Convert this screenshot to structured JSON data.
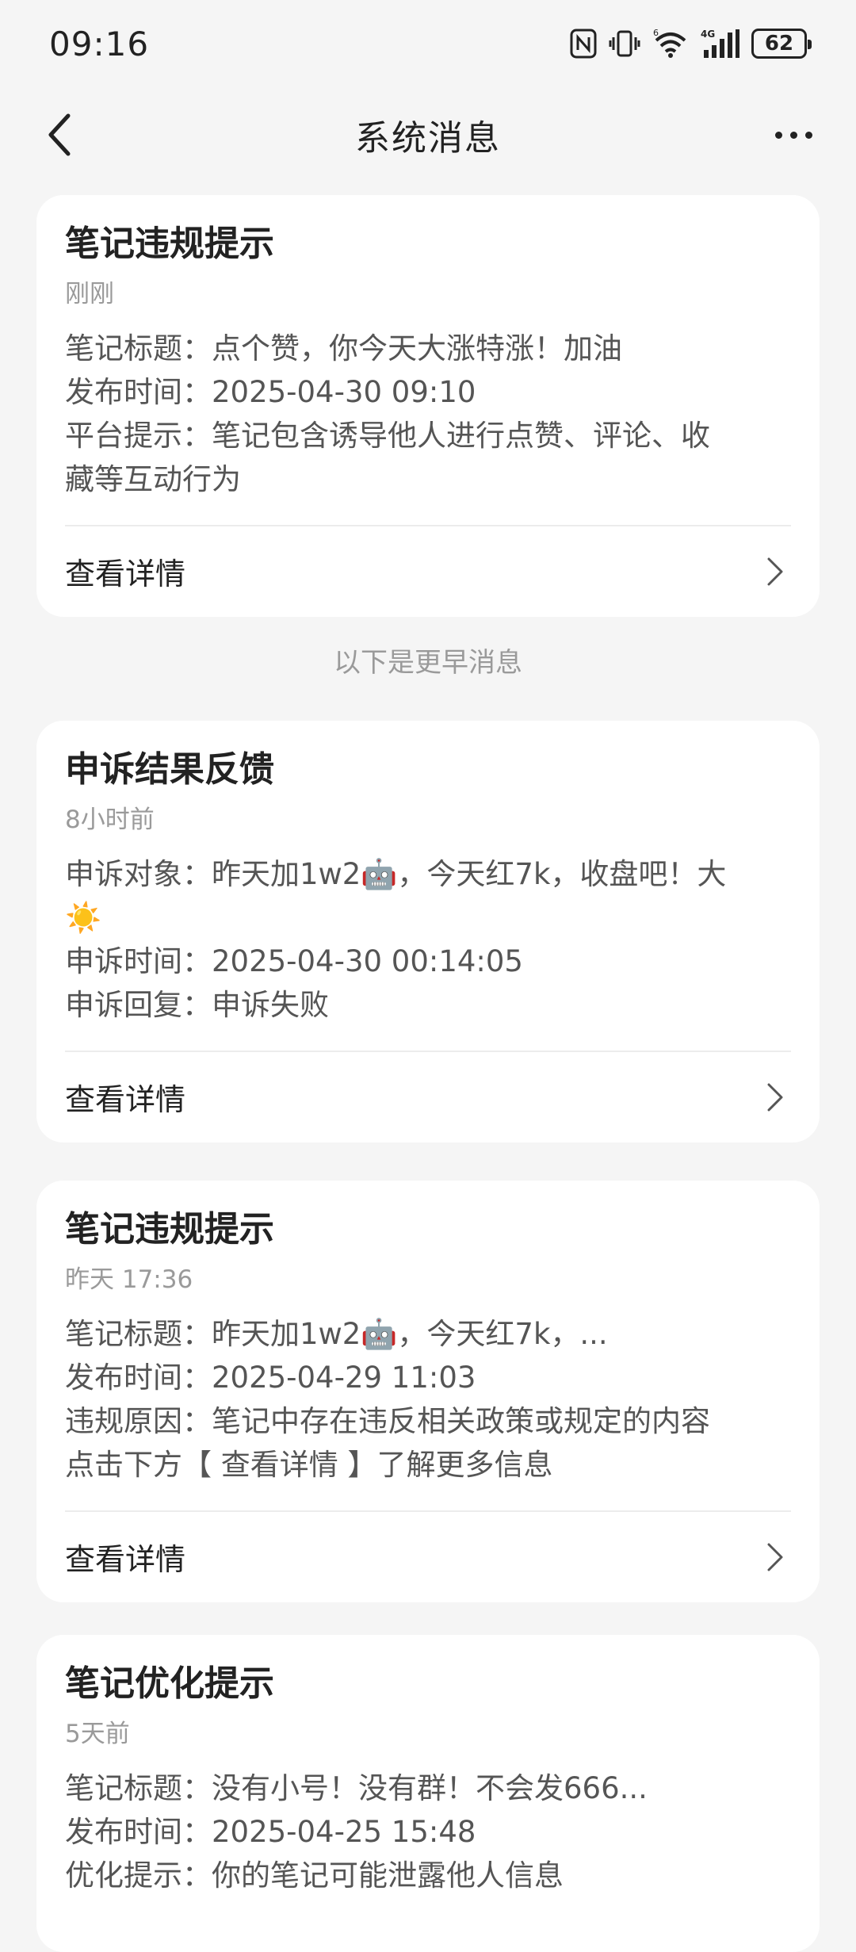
{
  "status_bar": {
    "time": "09:16",
    "battery": "62",
    "signal_label": "4G",
    "wifi_label": "6"
  },
  "nav": {
    "title": "系统消息"
  },
  "separator_text": "以下是更早消息",
  "cards": [
    {
      "title": "笔记违规提示",
      "time": "刚刚",
      "lines": [
        "笔记标题：点个赞，你今天大涨特涨！加油",
        "发布时间：2025-04-30 09:10",
        "平台提示：笔记包含诱导他人进行点赞、评论、收",
        "藏等互动行为"
      ],
      "detail_label": "查看详情"
    },
    {
      "title": "申诉结果反馈",
      "time": "8小时前",
      "lines": [
        "申诉对象：昨天加1w2🤖，今天红7k，收盘吧！大",
        "☀️",
        "申诉时间：2025-04-30 00:14:05",
        "申诉回复：申诉失败"
      ],
      "detail_label": "查看详情"
    },
    {
      "title": "笔记违规提示",
      "time": "昨天 17:36",
      "lines": [
        "笔记标题：昨天加1w2🤖，今天红7k，...",
        "发布时间：2025-04-29 11:03",
        "违规原因：笔记中存在违反相关政策或规定的内容",
        "点击下方【 查看详情 】了解更多信息"
      ],
      "detail_label": "查看详情"
    },
    {
      "title": "笔记优化提示",
      "time": "5天前",
      "lines": [
        "笔记标题：没有小号！没有群！不会发666...",
        "发布时间：2025-04-25 15:48",
        "优化提示：你的笔记可能泄露他人信息"
      ],
      "detail_label": "查看详情"
    }
  ]
}
